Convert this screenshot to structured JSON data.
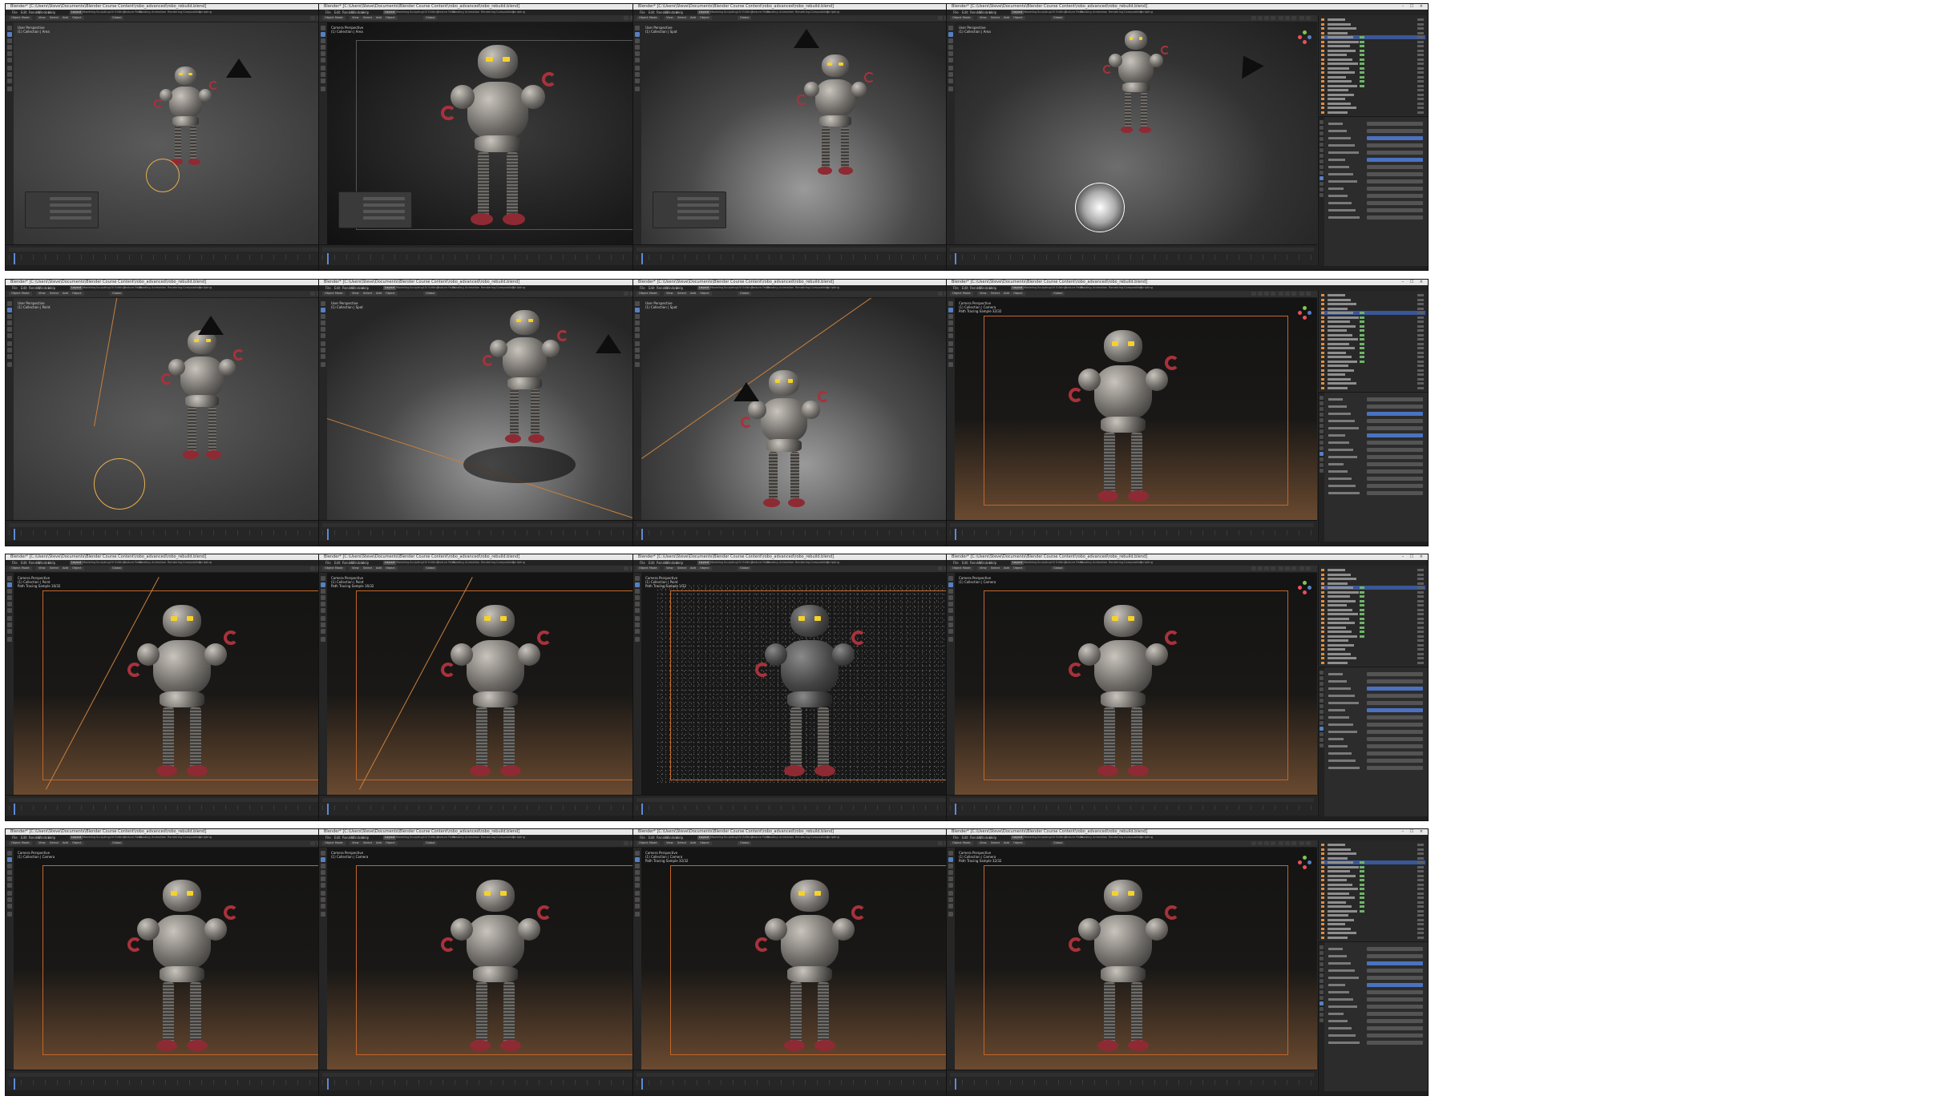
{
  "window": {
    "title": "Blender* [C:\\Users\\Steve\\Documents\\Blender Course Content\\robo_advanced\\robo_rebuild.blend]",
    "controls": "– ☐ ×"
  },
  "menu": [
    "File",
    "Edit",
    "Render",
    "Window",
    "Help"
  ],
  "workspace_tabs": [
    "Layout",
    "Modeling",
    "Sculpting",
    "UV Editing",
    "Texture Paint",
    "Shading",
    "Animation",
    "Rendering",
    "Compositing",
    "Scripting"
  ],
  "header": {
    "mode": "Object Mode",
    "view": "View",
    "select": "Select",
    "add": "Add",
    "object": "Object",
    "orientation": "Global"
  },
  "panels": [
    {
      "info": "User Perspective\n(1) Collection | Area",
      "tab": "Layout",
      "variant": "user-area-light"
    },
    {
      "info": "Camera Perspective\n(1) Collection | Area",
      "tab": "Layout",
      "variant": "camera-dark"
    },
    {
      "info": "User Perspective\n(1) Collection | Spot",
      "tab": "Layout",
      "variant": "user-spot-wheel"
    },
    {
      "info": "User Perspective\n(1) Collection | Area",
      "tab": "Layout",
      "variant": "user-area-glow"
    },
    {
      "info": "User Perspective\n(1) Collection | Point",
      "tab": "Layout",
      "variant": "user-point"
    },
    {
      "info": "User Perspective\n(1) Collection | Spot",
      "tab": "Layout",
      "variant": "user-spot-shadow"
    },
    {
      "info": "User Perspective\n(1) Collection | Spot",
      "tab": "Layout",
      "variant": "user-spot-close"
    },
    {
      "info": "Camera Perspective\n(1) Collection | Camera\nPath Tracing Sample 32/32",
      "tab": "Layout",
      "variant": "camera-render"
    },
    {
      "info": "Camera Perspective\n(1) Collection | Point\nPath Tracing Sample 16/32",
      "tab": "Layout",
      "variant": "camera-beam"
    },
    {
      "info": "Camera Perspective\n(1) Collection | Point\nPath Tracing Sample 16/32",
      "tab": "Layout",
      "variant": "camera-beam"
    },
    {
      "info": "Camera Perspective\n(1) Collection | Point\nPath Tracing Sample 1/32",
      "tab": "Layout",
      "variant": "camera-noise"
    },
    {
      "info": "Camera Perspective\n(1) Collection | Camera",
      "tab": "Layout",
      "variant": "camera-warm"
    },
    {
      "info": "Camera Perspective\n(1) Collection | Camera",
      "tab": "Layout",
      "variant": "camera-warm"
    },
    {
      "info": "Camera Perspective\n(1) Collection | Camera",
      "tab": "Layout",
      "variant": "camera-warm"
    },
    {
      "info": "Camera Perspective\n(1) Collection | Camera\nPath Tracing Sample 32/32",
      "tab": "Layout",
      "variant": "camera-warm"
    },
    {
      "info": "Camera Perspective\n(1) Collection | Camera\nPath Tracing Sample 32/32",
      "tab": "Layout",
      "variant": "camera-warm"
    }
  ],
  "colors": {
    "selection": "#3a5796",
    "accent": "#5680c2",
    "camera_frame": "#c2662a",
    "light_gizmo": "#e7b04e"
  }
}
